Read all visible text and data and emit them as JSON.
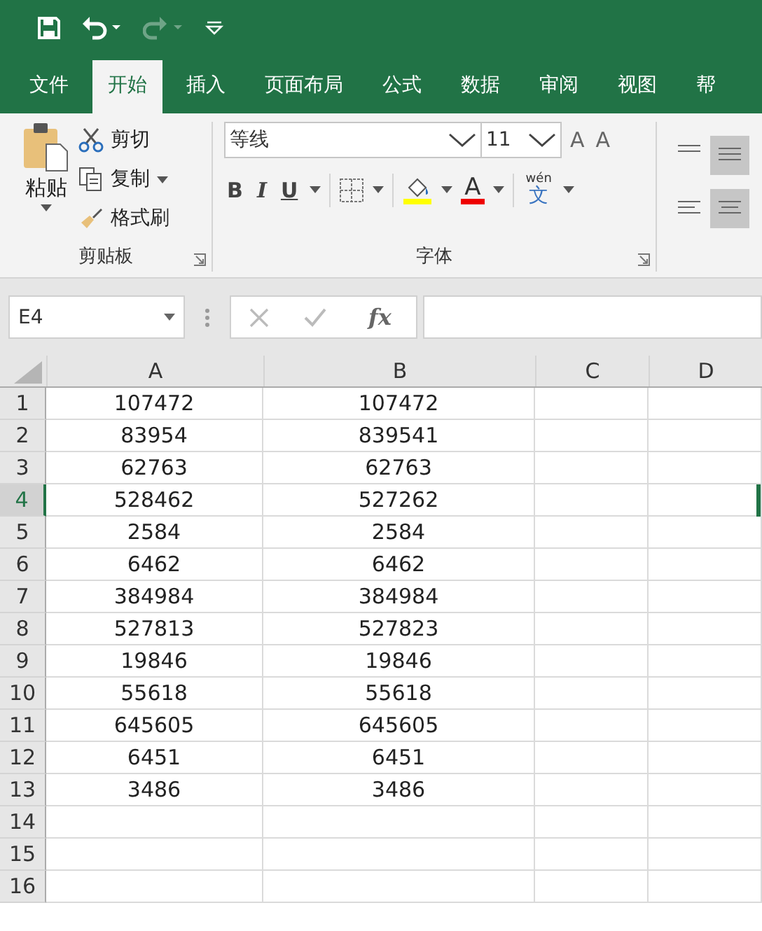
{
  "quick_access": {
    "undo_enabled": true,
    "redo_enabled": false
  },
  "tabs": [
    {
      "label": "文件",
      "selected": false
    },
    {
      "label": "开始",
      "selected": true
    },
    {
      "label": "插入",
      "selected": false
    },
    {
      "label": "页面布局",
      "selected": false
    },
    {
      "label": "公式",
      "selected": false
    },
    {
      "label": "数据",
      "selected": false
    },
    {
      "label": "审阅",
      "selected": false
    },
    {
      "label": "视图",
      "selected": false
    },
    {
      "label": "帮",
      "selected": false
    }
  ],
  "clipboard": {
    "paste": "粘贴",
    "cut": "剪切",
    "copy": "复制",
    "format_painter": "格式刷",
    "label": "剪贴板"
  },
  "font": {
    "family": "等线",
    "size": "11",
    "grow": "A",
    "shrink": "A",
    "bold": "B",
    "italic": "I",
    "underline": "U",
    "font_color": "A",
    "phonetic_top": "wén",
    "phonetic_char": "文",
    "label": "字体"
  },
  "formula_bar": {
    "name_box": "E4",
    "fx": "fx"
  },
  "columns": [
    {
      "label": "A",
      "selected": false
    },
    {
      "label": "B",
      "selected": false
    },
    {
      "label": "C",
      "selected": false
    },
    {
      "label": "D",
      "selected": false
    }
  ],
  "rows": [
    {
      "number": "1",
      "selected": false,
      "cells": [
        "107472",
        "107472"
      ]
    },
    {
      "number": "2",
      "selected": false,
      "cells": [
        "83954",
        "839541"
      ]
    },
    {
      "number": "3",
      "selected": false,
      "cells": [
        "62763",
        "62763"
      ]
    },
    {
      "number": "4",
      "selected": true,
      "cells": [
        "528462",
        "527262"
      ]
    },
    {
      "number": "5",
      "selected": false,
      "cells": [
        "2584",
        "2584"
      ]
    },
    {
      "number": "6",
      "selected": false,
      "cells": [
        "6462",
        "6462"
      ]
    },
    {
      "number": "7",
      "selected": false,
      "cells": [
        "384984",
        "384984"
      ]
    },
    {
      "number": "8",
      "selected": false,
      "cells": [
        "527813",
        "527823"
      ]
    },
    {
      "number": "9",
      "selected": false,
      "cells": [
        "19846",
        "19846"
      ]
    },
    {
      "number": "10",
      "selected": false,
      "cells": [
        "55618",
        "55618"
      ]
    },
    {
      "number": "11",
      "selected": false,
      "cells": [
        "645605",
        "645605"
      ]
    },
    {
      "number": "12",
      "selected": false,
      "cells": [
        "6451",
        "6451"
      ]
    },
    {
      "number": "13",
      "selected": false,
      "cells": [
        "3486",
        "3486"
      ]
    },
    {
      "number": "14",
      "selected": false
    },
    {
      "number": "15",
      "selected": false
    },
    {
      "number": "16",
      "selected": false
    }
  ]
}
